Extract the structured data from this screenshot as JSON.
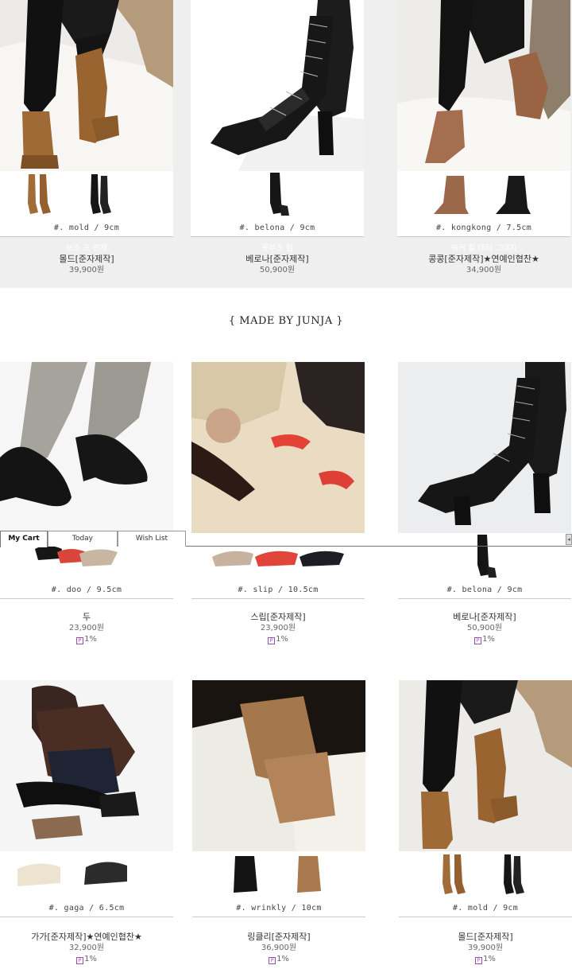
{
  "section_title": "{ MADE BY JUNJA }",
  "quickbar": {
    "tabs": [
      "My Cart",
      "Today",
      "Wish List"
    ]
  },
  "row1": [
    {
      "code": "#. mold / 9cm",
      "tag": "보조 프 런제",
      "name": "몰드[준자제작]",
      "price": "39,900원"
    },
    {
      "code": "#. belona / 9cm",
      "tag": "롱부츠 힘",
      "name": "베로나[준자제작]",
      "price": "50,900원"
    },
    {
      "code": "#. kongkong / 7.5cm",
      "tag": "워커 힐 태티 그대지",
      "name": "콩콩[준자제작]★연예인협찬★",
      "price": "34,900원"
    }
  ],
  "row2": [
    {
      "code": "#. doo / 9.5cm",
      "name": "두",
      "price": "23,900원",
      "point": "1%"
    },
    {
      "code": "#. slip / 10.5cm",
      "name": "스립[준자제작]",
      "price": "23,900원",
      "point": "1%"
    },
    {
      "code": "#. belona / 9cm",
      "name": "베로나[준자제작]",
      "price": "50,900원",
      "point": "1%"
    }
  ],
  "row3": [
    {
      "code": "#. gaga / 6.5cm",
      "name": "가가[준자제작]★연예인협찬★",
      "price": "32,900원",
      "point": "1%"
    },
    {
      "code": "#. wrinkly / 10cm",
      "name": "링클리[준자제작]",
      "price": "36,900원",
      "point": "1%"
    },
    {
      "code": "#. mold / 9cm",
      "name": "몰드[준자제작]",
      "price": "39,900원",
      "point": "1%"
    }
  ],
  "colors": {
    "band": "#efefef",
    "point_icon": "#9a4cb8",
    "brown_boot": "#8b5a2b",
    "black_boot": "#1b1b1b",
    "red_heel": "#e0443a"
  }
}
